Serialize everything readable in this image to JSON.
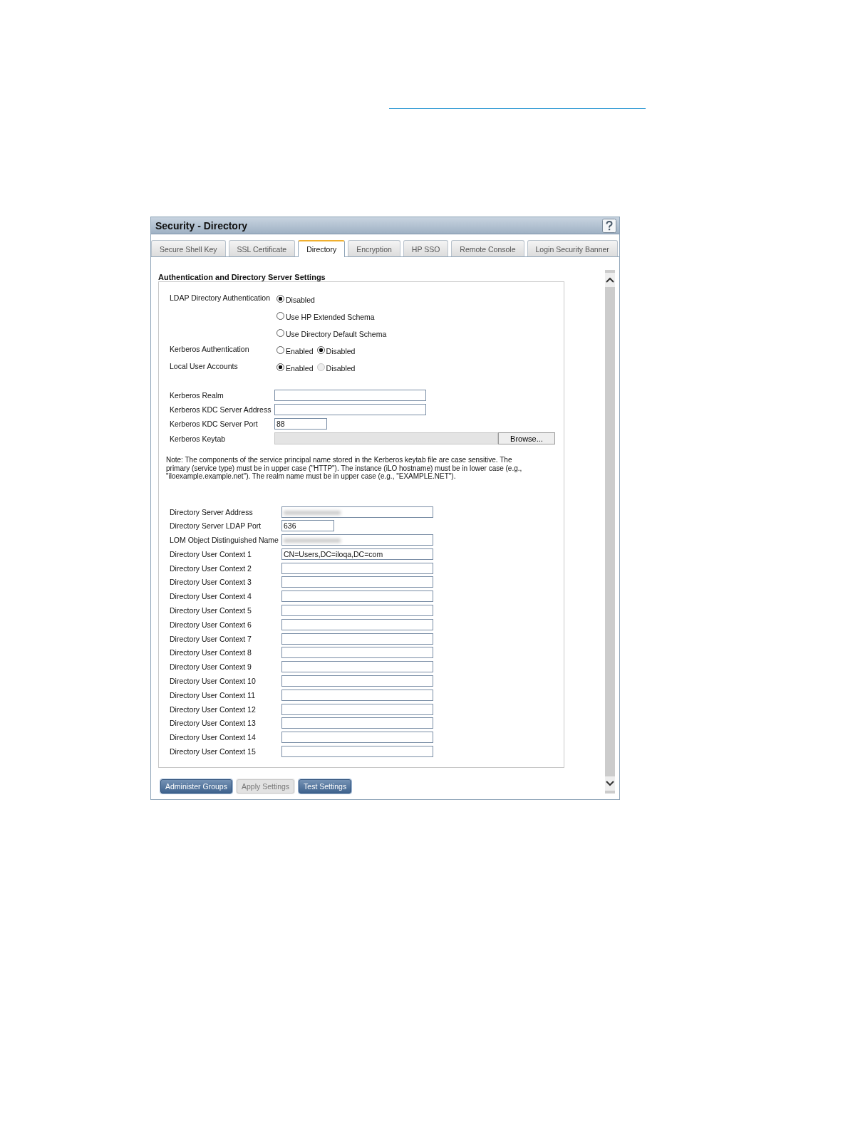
{
  "window": {
    "title": "Security - Directory"
  },
  "tabs": [
    {
      "label": "Secure Shell Key",
      "selected": false
    },
    {
      "label": "SSL Certificate",
      "selected": false
    },
    {
      "label": "Directory",
      "selected": true
    },
    {
      "label": "Encryption",
      "selected": false
    },
    {
      "label": "HP SSO",
      "selected": false
    },
    {
      "label": "Remote Console",
      "selected": false
    },
    {
      "label": "Login Security Banner",
      "selected": false
    }
  ],
  "section_title": "Authentication and Directory Server Settings",
  "radio_groups": [
    {
      "label": "LDAP Directory Authentication",
      "kind": "stacked",
      "options": [
        {
          "label": "Disabled",
          "selected": true,
          "disabled": false
        },
        {
          "label": "Use HP Extended Schema",
          "selected": false,
          "disabled": false
        },
        {
          "label": "Use Directory Default Schema",
          "selected": false,
          "disabled": false
        }
      ]
    },
    {
      "label": "Kerberos Authentication",
      "kind": "inline",
      "options": [
        {
          "label": "Enabled",
          "selected": false,
          "disabled": false
        },
        {
          "label": "Disabled",
          "selected": true,
          "disabled": false
        }
      ]
    },
    {
      "label": "Local User Accounts",
      "kind": "inline",
      "options": [
        {
          "label": "Enabled",
          "selected": true,
          "disabled": false
        },
        {
          "label": "Disabled",
          "selected": false,
          "disabled": true
        }
      ]
    }
  ],
  "kerberos_fields": [
    {
      "label": "Kerberos Realm",
      "kind": "wide"
    },
    {
      "label": "Kerberos KDC Server Address",
      "kind": "wide"
    },
    {
      "label": "Kerberos KDC Server Port",
      "kind": "short",
      "value": "88"
    },
    {
      "label": "Kerberos Keytab",
      "kind": "file",
      "button": "Browse..."
    }
  ],
  "note": "Note: The components of the service principal name stored in the Kerberos keytab file are case sensitive. The primary (service type) must be in upper case (\"HTTP\"). The instance (iLO hostname) must be in lower case (e.g., \"iloexample.example.net\"). The realm name must be in upper case (e.g., \"EXAMPLE.NET\").",
  "directory_fields": [
    {
      "label": "Directory Server Address",
      "kind": "blurred"
    },
    {
      "label": "Directory Server LDAP Port",
      "kind": "short",
      "value": "636"
    },
    {
      "label": "LOM Object Distinguished Name",
      "kind": "blurred"
    },
    {
      "label": "Directory User Context 1",
      "kind": "wide",
      "value": "CN=Users,DC=iloqa,DC=com"
    },
    {
      "label": "Directory User Context 2",
      "kind": "wide"
    },
    {
      "label": "Directory User Context 3",
      "kind": "wide"
    },
    {
      "label": "Directory User Context 4",
      "kind": "wide"
    },
    {
      "label": "Directory User Context 5",
      "kind": "wide"
    },
    {
      "label": "Directory User Context 6",
      "kind": "wide"
    },
    {
      "label": "Directory User Context 7",
      "kind": "wide"
    },
    {
      "label": "Directory User Context 8",
      "kind": "wide"
    },
    {
      "label": "Directory User Context 9",
      "kind": "wide"
    },
    {
      "label": "Directory User Context 10",
      "kind": "wide"
    },
    {
      "label": "Directory User Context 11",
      "kind": "wide"
    },
    {
      "label": "Directory User Context 12",
      "kind": "wide"
    },
    {
      "label": "Directory User Context 13",
      "kind": "wide"
    },
    {
      "label": "Directory User Context 14",
      "kind": "wide"
    },
    {
      "label": "Directory User Context 15",
      "kind": "wide"
    }
  ],
  "buttons": [
    {
      "label": "Administer Groups",
      "disabled": false
    },
    {
      "label": "Apply Settings",
      "disabled": true
    },
    {
      "label": "Test Settings",
      "disabled": false
    }
  ]
}
